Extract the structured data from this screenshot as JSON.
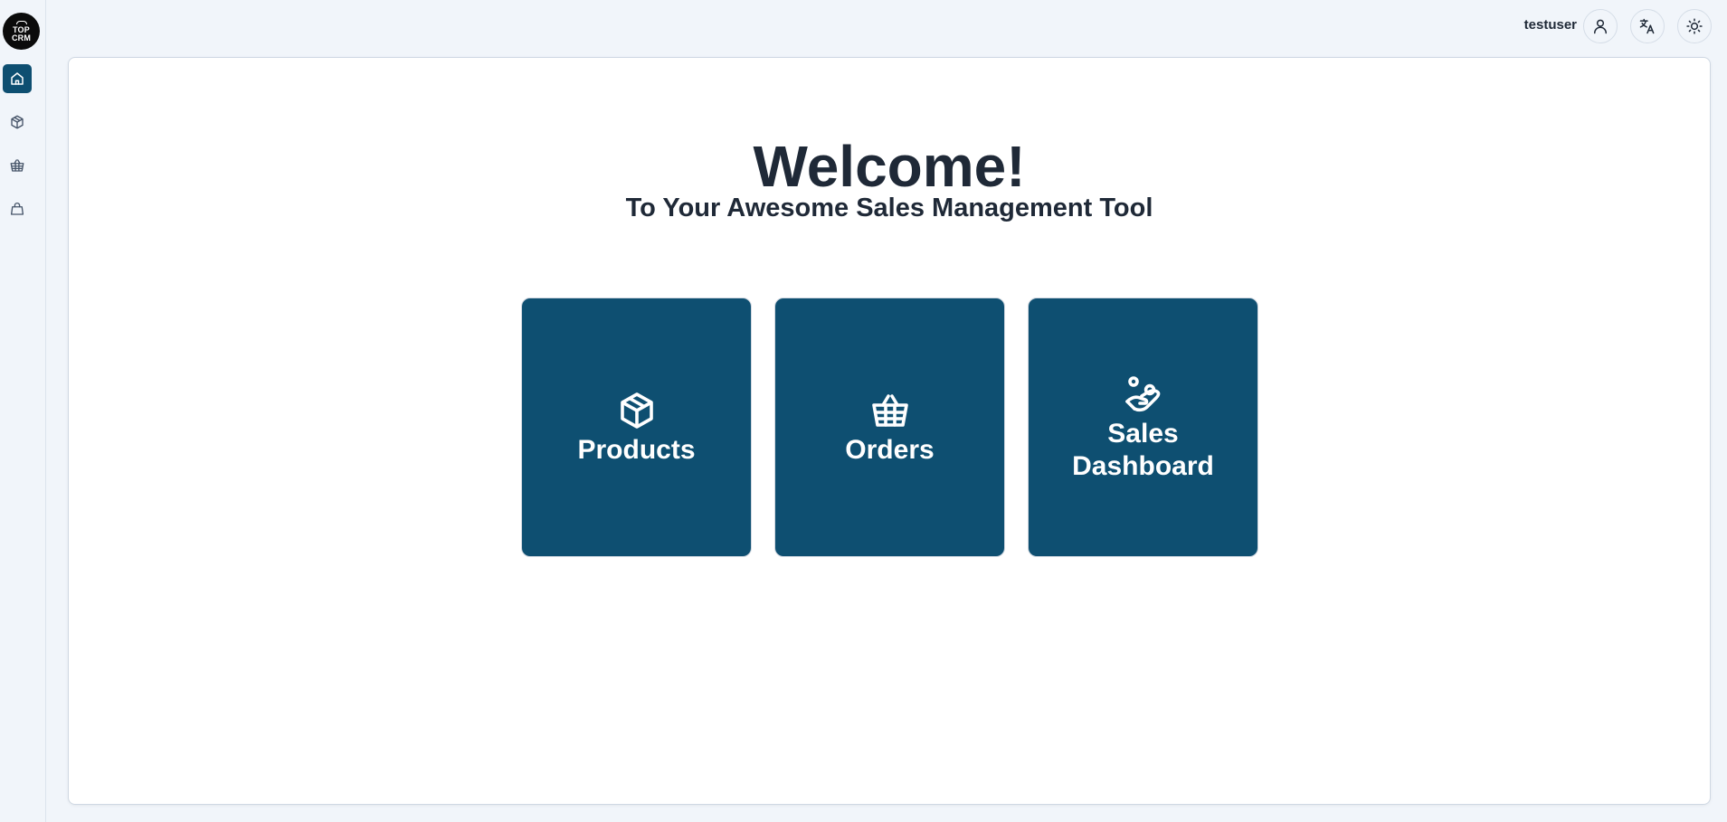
{
  "app": {
    "logo_text_line1": "TOP",
    "logo_text_line2": "CRM"
  },
  "sidebar": {
    "items": [
      {
        "name": "home",
        "icon": "home-icon",
        "active": true
      },
      {
        "name": "products",
        "icon": "cube-icon",
        "active": false
      },
      {
        "name": "orders",
        "icon": "basket-icon",
        "active": false
      },
      {
        "name": "sales",
        "icon": "bag-icon",
        "active": false
      }
    ]
  },
  "topbar": {
    "username": "testuser",
    "user_icon": "user-icon",
    "language_icon": "translate-icon",
    "theme_icon": "sun-icon"
  },
  "main": {
    "title": "Welcome!",
    "subtitle": "To Your Awesome Sales Management Tool",
    "cards": [
      {
        "label": "Products",
        "icon": "cube-icon"
      },
      {
        "label": "Orders",
        "icon": "basket-icon"
      },
      {
        "label": "Sales Dashboard",
        "icon": "hand-coin-icon"
      }
    ]
  },
  "colors": {
    "accent": "#0e4f71",
    "background": "#f1f5fa",
    "panel": "#ffffff",
    "text": "#1f2937"
  }
}
